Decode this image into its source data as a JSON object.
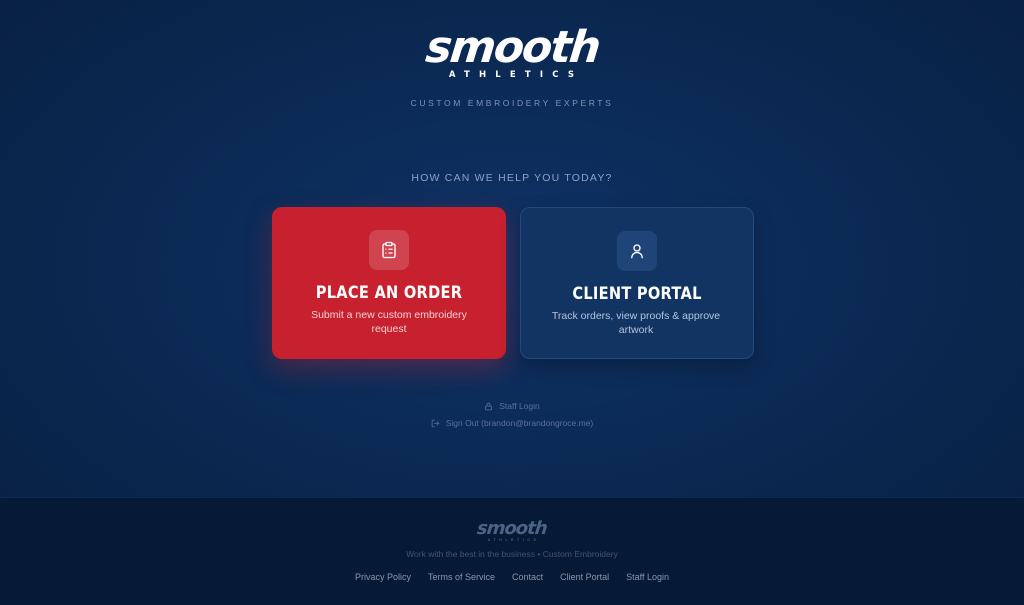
{
  "brand": {
    "logo_word": "smooth",
    "logo_sub": "ATHLETICS",
    "tagline": "CUSTOM EMBROIDERY EXPERTS"
  },
  "prompt": "HOW CAN WE HELP YOU TODAY?",
  "cards": {
    "order": {
      "title": "PLACE AN ORDER",
      "description": "Submit a new custom embroidery request",
      "icon": "clipboard-icon",
      "color": "#c7212f"
    },
    "portal": {
      "title": "CLIENT PORTAL",
      "description": "Track orders, view proofs & approve artwork",
      "icon": "user-icon",
      "color": "#123463"
    }
  },
  "links": {
    "staff_login": "Staff Login",
    "sign_out": "Sign Out (brandon@brandongroce.me)"
  },
  "footer": {
    "logo_word": "smooth",
    "logo_sub": "ATHLETICS",
    "tagline": "Work with the best in the business • Custom Embroidery",
    "nav": [
      "Privacy Policy",
      "Terms of Service",
      "Contact",
      "Client Portal",
      "Staff Login"
    ]
  },
  "colors": {
    "background": "#0b2a55",
    "accent_red": "#c7212f",
    "footer_bg": "#061a36"
  }
}
